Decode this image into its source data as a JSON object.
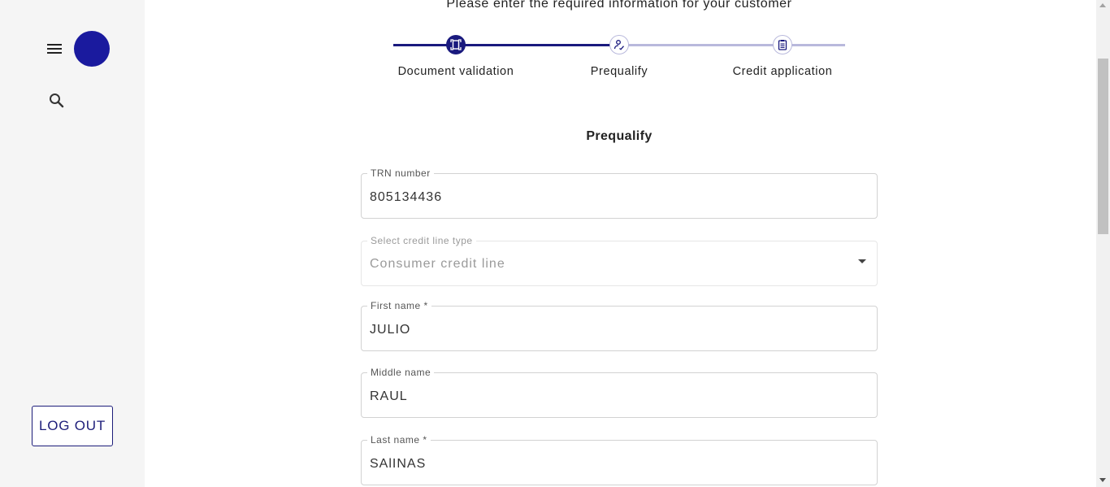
{
  "header": {
    "intro_text": "Please enter the required information for your customer"
  },
  "sidebar": {
    "logout_label": "LOG OUT"
  },
  "stepper": {
    "steps": [
      {
        "label": "Document validation",
        "icon": "document-scan-icon",
        "state": "completed"
      },
      {
        "label": "Prequalify",
        "icon": "signature-icon",
        "state": "active"
      },
      {
        "label": "Credit application",
        "icon": "clipboard-list-icon",
        "state": "pending"
      }
    ],
    "progress_fraction": 0.5
  },
  "form": {
    "title": "Prequalify",
    "trn": {
      "label": "TRN number",
      "value": "805134436"
    },
    "credit_line_type": {
      "label": "Select credit line type",
      "value": "Consumer credit line"
    },
    "first_name": {
      "label": "First name *",
      "value": "JULIO"
    },
    "middle_name": {
      "label": "Middle name",
      "value": "RAUL"
    },
    "last_name": {
      "label": "Last name *",
      "value": "SAlINAS"
    }
  },
  "colors": {
    "primary": "#1a1a7e",
    "avatar": "#1a1a9e",
    "step_pending": "#b9b9dc",
    "sidebar_bg": "#f5f5f5"
  }
}
